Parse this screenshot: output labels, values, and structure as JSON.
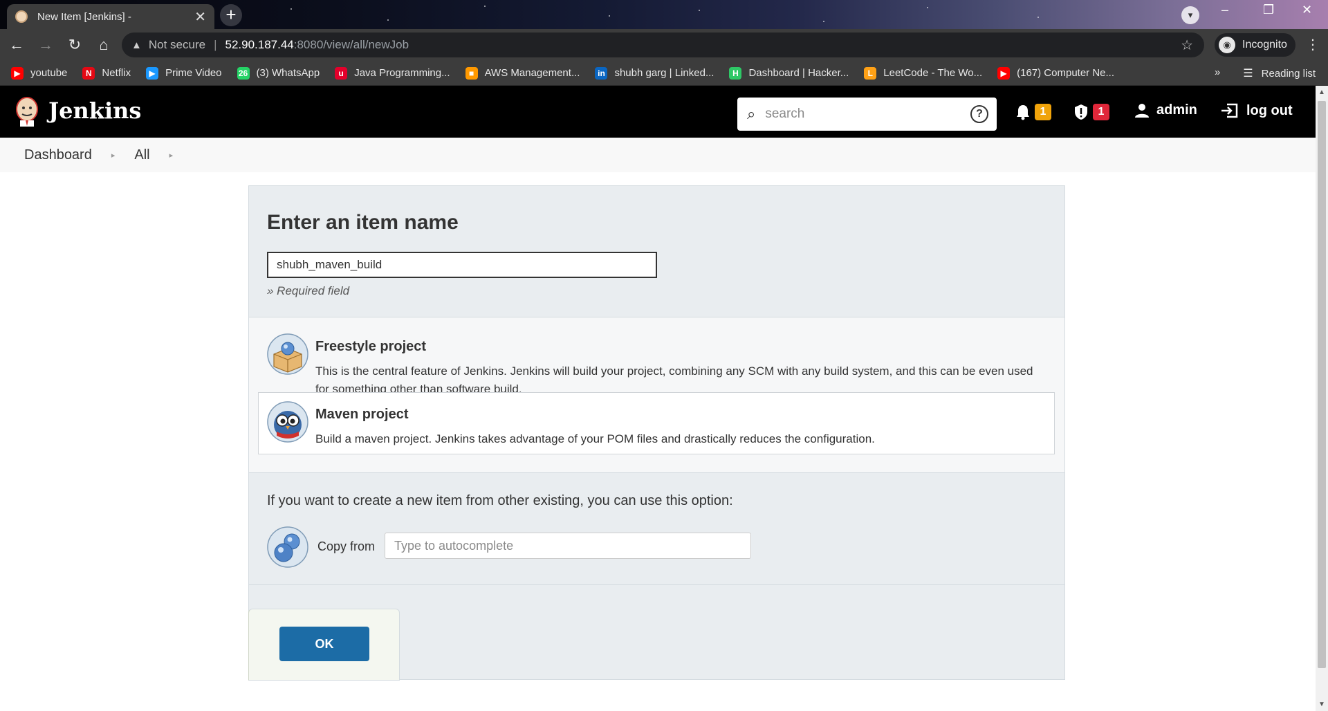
{
  "browser": {
    "tab_title": "New Item [Jenkins] -",
    "address": {
      "security_label": "Not secure",
      "host": "52.90.187.44",
      "path": ":8080/view/all/newJob"
    },
    "profile_label": "Incognito",
    "bookmarks": [
      {
        "label": "youtube",
        "icon": "youtube-icon",
        "color": "#ff0000",
        "glyph": "▶"
      },
      {
        "label": "Netflix",
        "icon": "netflix-icon",
        "color": "#e50914",
        "glyph": "N"
      },
      {
        "label": "Prime Video",
        "icon": "prime-video-icon",
        "color": "#1a98ff",
        "glyph": "▶"
      },
      {
        "label": "(3) WhatsApp",
        "icon": "whatsapp-icon",
        "color": "#25d366",
        "glyph": "26"
      },
      {
        "label": "Java Programming...",
        "icon": "udemy-icon",
        "color": "#e4002b",
        "glyph": "u"
      },
      {
        "label": "AWS Management...",
        "icon": "aws-icon",
        "color": "#ff9900",
        "glyph": "■"
      },
      {
        "label": "shubh garg | Linked...",
        "icon": "linkedin-icon",
        "color": "#0a66c2",
        "glyph": "in"
      },
      {
        "label": "Dashboard | Hacker...",
        "icon": "hackerrank-icon",
        "color": "#2ec866",
        "glyph": "H"
      },
      {
        "label": "LeetCode - The Wo...",
        "icon": "leetcode-icon",
        "color": "#ffa116",
        "glyph": "L"
      },
      {
        "label": "(167) Computer Ne...",
        "icon": "youtube-icon",
        "color": "#ff0000",
        "glyph": "▶"
      }
    ],
    "overflow": "»",
    "reading_list_label": "Reading list"
  },
  "header": {
    "brand": "Jenkins",
    "search_placeholder": "search",
    "notifications_count": "1",
    "notifications_color": "#f0a30a",
    "security_count": "1",
    "security_color": "#e0273a",
    "user": "admin",
    "logout_label": "log out"
  },
  "breadcrumb": {
    "items": [
      "Dashboard",
      "All"
    ]
  },
  "form": {
    "heading": "Enter an item name",
    "item_name_value": "shubh_maven_build",
    "required_hint": "» Required field",
    "item_types": [
      {
        "title": "Freestyle project",
        "description": "This is the central feature of Jenkins. Jenkins will build your project, combining any SCM with any build system, and this can be even used for something other than software build.",
        "icon": "freestyle-project-icon",
        "selected": false
      },
      {
        "title": "Maven project",
        "description": "Build a maven project. Jenkins takes advantage of your POM files and drastically reduces the configuration.",
        "icon": "maven-project-icon",
        "selected": true
      }
    ],
    "copy_hint": "If you want to create a new item from other existing, you can use this option:",
    "copy_label": "Copy from",
    "copy_placeholder": "Type to autocomplete",
    "ok_label": "OK"
  }
}
